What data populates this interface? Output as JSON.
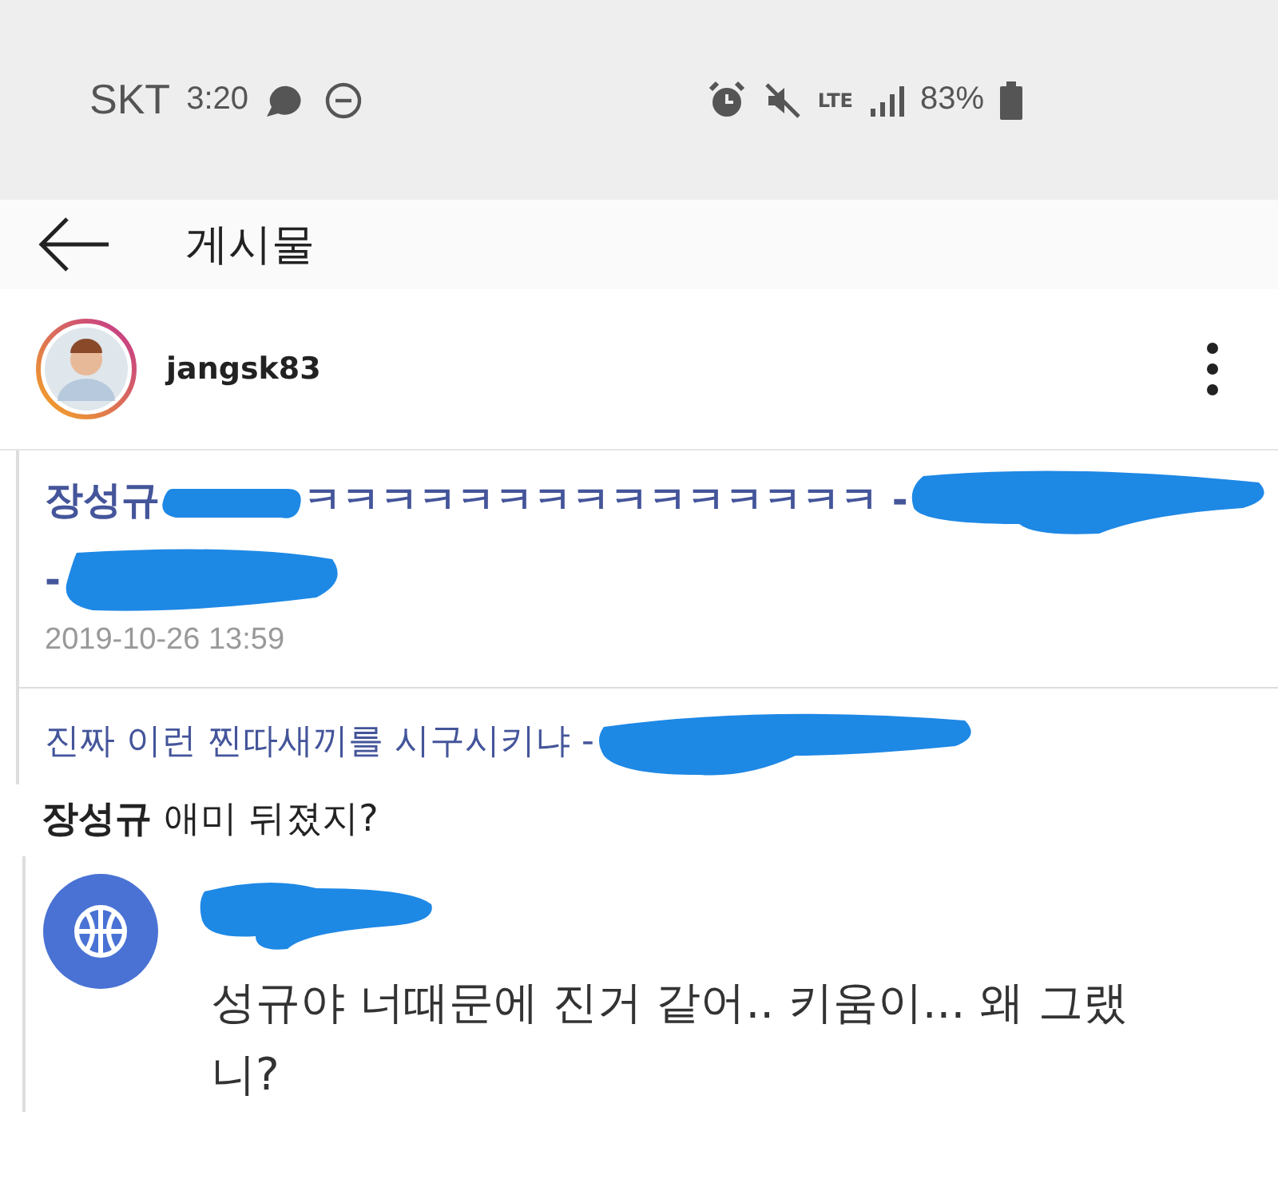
{
  "status_bar": {
    "carrier": "SKT",
    "time": "3:20",
    "network": "LTE",
    "battery": "83%"
  },
  "header": {
    "title": "게시물"
  },
  "post": {
    "username": "jangsk83"
  },
  "items": [
    {
      "kind": "quote",
      "author": "장성규",
      "text": "ㅋㅋㅋㅋㅋㅋㅋㅋㅋㅋㅋㅋㅋㅋㅋ -",
      "line_2": "-",
      "date": "2019-10-26 13:59"
    },
    {
      "kind": "title",
      "text": "진짜 이런 찐따새끼를 시구시키냐 -"
    },
    {
      "kind": "headline",
      "author": "장성규",
      "text": "애미 뒤졌지?"
    },
    {
      "kind": "reply",
      "text": "성규야 너때문에 진거 같어.. 키움이... 왜 그랬니?"
    }
  ]
}
